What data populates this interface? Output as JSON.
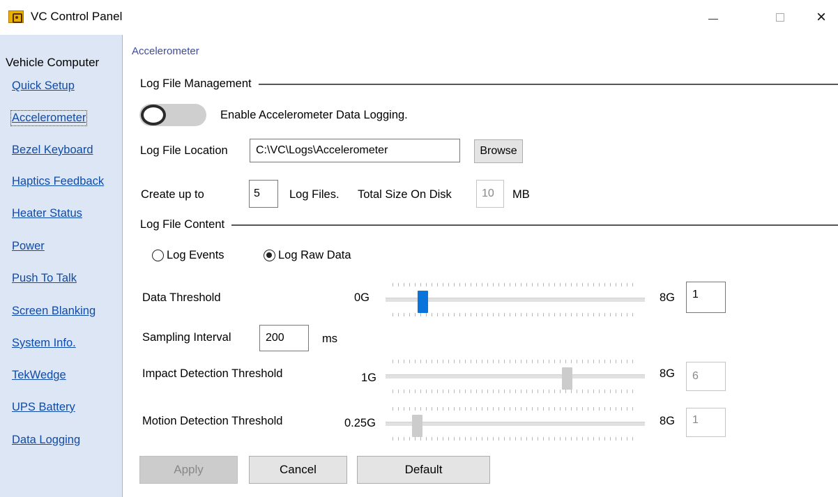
{
  "window": {
    "title": "VC Control Panel",
    "close_glyph": "×"
  },
  "sidebar": {
    "heading": "Vehicle Computer",
    "items": [
      {
        "label": "Quick Setup"
      },
      {
        "label": "Accelerometer",
        "active": true
      },
      {
        "label": "Bezel Keyboard"
      },
      {
        "label": "Haptics Feedback"
      },
      {
        "label": "Heater Status"
      },
      {
        "label": "Power"
      },
      {
        "label": "Push To Talk"
      },
      {
        "label": "Screen Blanking"
      },
      {
        "label": "System Info."
      },
      {
        "label": "TekWedge"
      },
      {
        "label": "UPS Battery"
      },
      {
        "label": "Data Logging"
      }
    ]
  },
  "main": {
    "breadcrumb": "Accelerometer",
    "log_file_management": {
      "heading": "Log File Management",
      "enable_toggle": {
        "on": false,
        "label": "Enable Accelerometer Data Logging."
      },
      "location_label": "Log File Location",
      "location_value": "C:\\VC\\Logs\\Accelerometer",
      "browse_label": "Browse",
      "create_prefix": "Create up to",
      "file_count": "5",
      "files_label": "Log Files.",
      "total_size_label": "Total Size On Disk",
      "total_size_value": "10",
      "size_unit": "MB"
    },
    "log_file_content": {
      "heading": "Log File Content",
      "radio_events": "Log Events",
      "radio_raw": "Log Raw Data",
      "selected": "Log Raw Data",
      "data_threshold": {
        "label": "Data Threshold",
        "min": "0G",
        "max": "8G",
        "value": "1"
      },
      "sampling_interval": {
        "label": "Sampling Interval",
        "value": "200",
        "unit": "ms"
      },
      "impact_threshold": {
        "label": "Impact Detection Threshold",
        "min": "1G",
        "max": "8G",
        "value": "6"
      },
      "motion_threshold": {
        "label": "Motion Detection Threshold",
        "min": "0.25G",
        "max": "8G",
        "value": "1"
      }
    },
    "buttons": {
      "apply": "Apply",
      "cancel": "Cancel",
      "default": "Default"
    }
  },
  "colors": {
    "sidebar_bg": "#dce6f5",
    "link": "#0f4ba8",
    "slider_active": "#0a74da",
    "slider_disabled": "#cccccc"
  }
}
